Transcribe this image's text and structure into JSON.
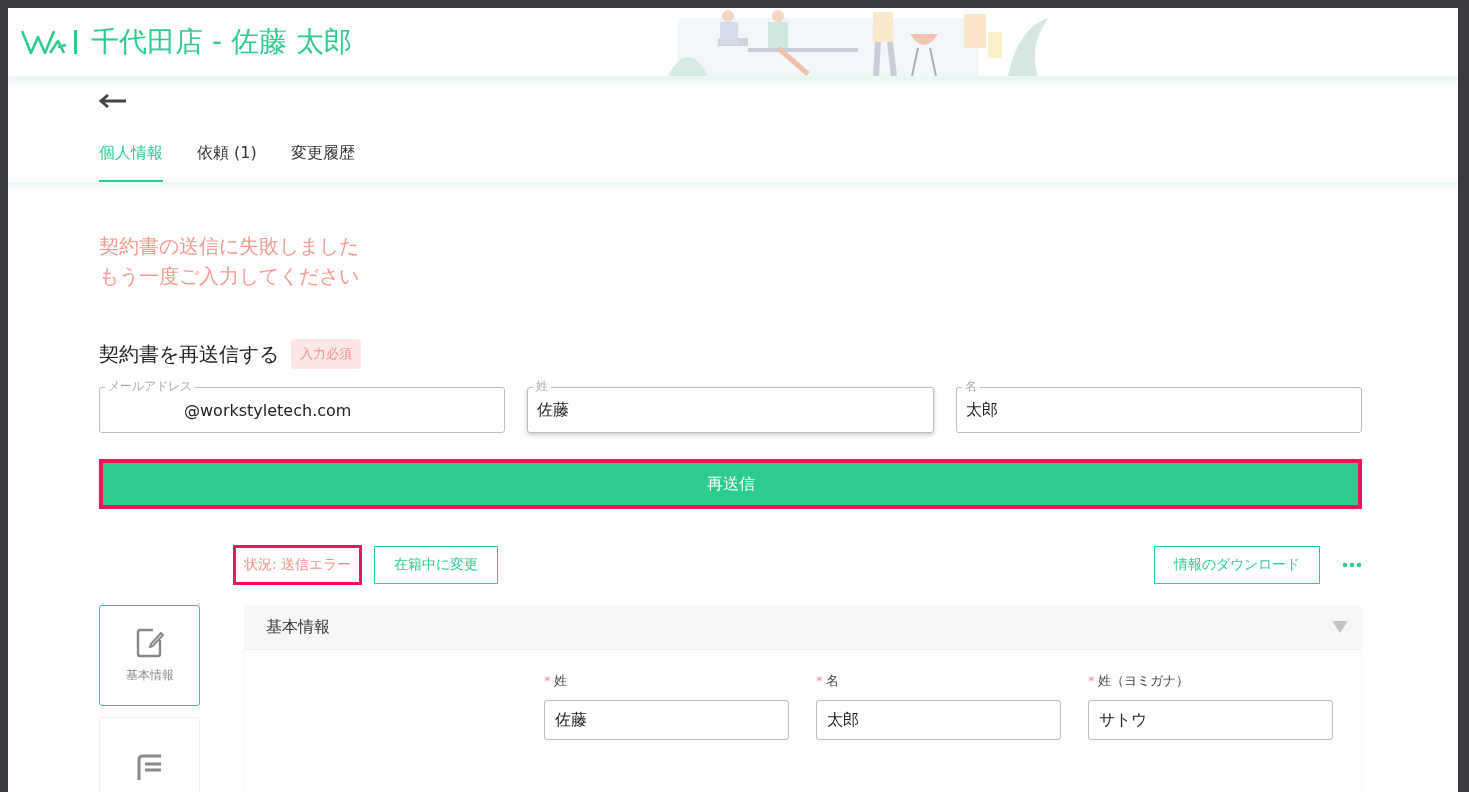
{
  "header": {
    "title": "千代田店 - 佐藤 太郎"
  },
  "tabs": [
    {
      "label": "個人情報",
      "selected": true
    },
    {
      "label": "依頼 (1)",
      "selected": false
    },
    {
      "label": "変更履歴",
      "selected": false
    }
  ],
  "error_message": [
    "契約書の送信に失敗しました",
    "もう一度ご入力してください"
  ],
  "resend": {
    "title": "契約書を再送信する",
    "required_badge": "入力必須",
    "fields": [
      {
        "label": "メールアドレス",
        "value": "@workstyletech.com",
        "focused": false
      },
      {
        "label": "姓",
        "value": "佐藤",
        "focused": true
      },
      {
        "label": "名",
        "value": "太郎",
        "focused": false
      }
    ],
    "button": {
      "label": "再送信",
      "highlighted": true
    }
  },
  "status": {
    "label": "状況: 送信エラー",
    "highlighted": true
  },
  "change_button": "在籍中に変更",
  "download_button": "情報のダウンロード",
  "sidebar": {
    "items": [
      {
        "label": "基本情報",
        "selected": true
      },
      {
        "selected": false
      }
    ]
  },
  "section": {
    "title": "基本情報",
    "expanded": true,
    "fields": [
      {
        "label": "姓",
        "required_mark": "*",
        "value": "佐藤"
      },
      {
        "label": "名",
        "required_mark": "*",
        "value": "太郎"
      },
      {
        "label": "姓（ヨミガナ）",
        "required_mark": "*",
        "value": "サトウ"
      }
    ]
  }
}
